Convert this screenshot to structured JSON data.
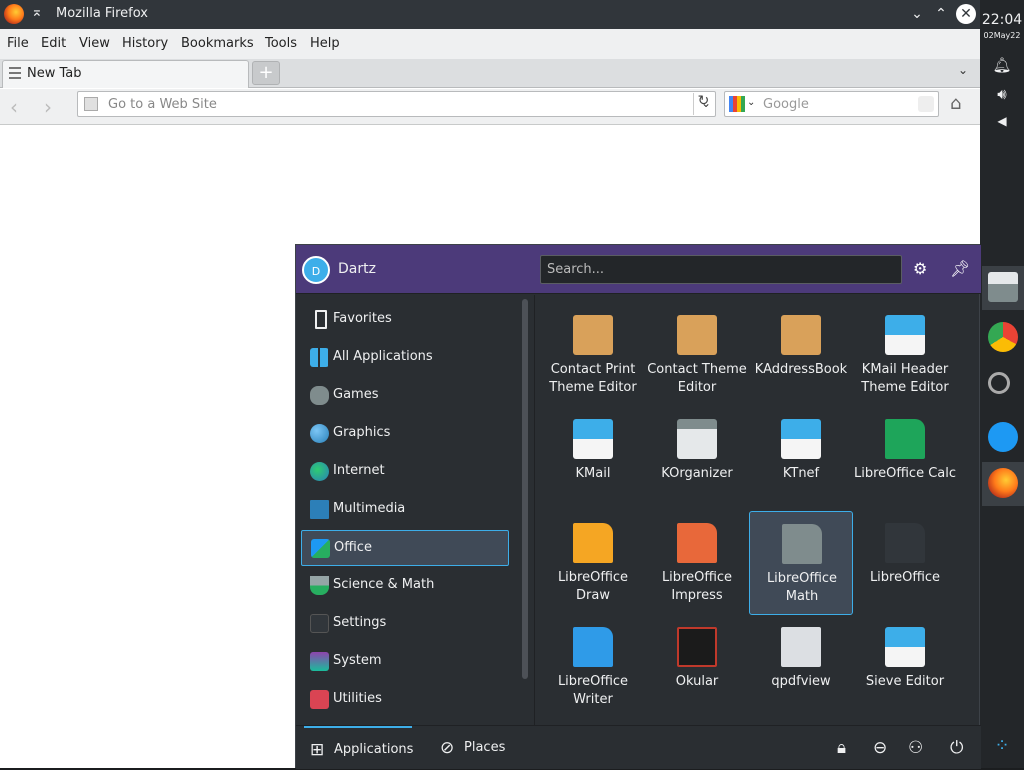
{
  "firefox": {
    "window_title": "Mozilla Firefox",
    "menu": [
      "File",
      "Edit",
      "View",
      "History",
      "Bookmarks",
      "Tools",
      "Help"
    ],
    "tab_label": "New Tab",
    "new_tab_symbol": "+",
    "url_placeholder": "Go to a Web Site",
    "search_placeholder": "Google"
  },
  "panel": {
    "time": "22:04",
    "date": "02May22"
  },
  "launcher": {
    "user": "Dartz",
    "avatar_initial": "D",
    "search_placeholder": "Search...",
    "categories": [
      {
        "label": "Favorites",
        "icon": "bookmark-icon",
        "color": "#2a2e32"
      },
      {
        "label": "All Applications",
        "icon": "grid-icon",
        "color": "#3daee9"
      },
      {
        "label": "Games",
        "icon": "gamepad-icon",
        "color": "#7f8c8d"
      },
      {
        "label": "Graphics",
        "icon": "graphics-icon",
        "color": "#2980b9"
      },
      {
        "label": "Internet",
        "icon": "globe-icon",
        "color": "#27ae60"
      },
      {
        "label": "Multimedia",
        "icon": "multimedia-icon",
        "color": "#2c7fb8"
      },
      {
        "label": "Office",
        "icon": "office-icon",
        "color": "#1d99f3"
      },
      {
        "label": "Science & Math",
        "icon": "flask-icon",
        "color": "#95a5a6"
      },
      {
        "label": "Settings",
        "icon": "settings-icon",
        "color": "#31363b"
      },
      {
        "label": "System",
        "icon": "system-icon",
        "color": "#8e44ad"
      },
      {
        "label": "Utilities",
        "icon": "utilities-icon",
        "color": "#da4453"
      }
    ],
    "selected_category": "Office",
    "apps": [
      {
        "label": "Contact Print Theme Editor",
        "icon": "addressbook-icon",
        "color": "#d9a15a"
      },
      {
        "label": "Contact Theme Editor",
        "icon": "addressbook-icon",
        "color": "#d9a15a"
      },
      {
        "label": "KAddressBook",
        "icon": "addressbook-icon",
        "color": "#d9a15a"
      },
      {
        "label": "KMail Header Theme Editor",
        "icon": "kmail-icon",
        "color": "#3daee9"
      },
      {
        "label": "KMail",
        "icon": "kmail-icon",
        "color": "#3daee9"
      },
      {
        "label": "KOrganizer",
        "icon": "calendar-icon",
        "color": "#e5e8ea"
      },
      {
        "label": "KTnef",
        "icon": "attachment-mail-icon",
        "color": "#3daee9"
      },
      {
        "label": "LibreOffice Calc",
        "icon": "calc-icon",
        "color": "#1ea55a"
      },
      {
        "label": "LibreOffice Draw",
        "icon": "draw-icon",
        "color": "#f5a623"
      },
      {
        "label": "LibreOffice Impress",
        "icon": "impress-icon",
        "color": "#e8683a"
      },
      {
        "label": "LibreOffice Math",
        "icon": "math-icon",
        "color": "#7f8c8d"
      },
      {
        "label": "LibreOffice",
        "icon": "libreoffice-icon",
        "color": "#31363b"
      },
      {
        "label": "LibreOffice Writer",
        "icon": "writer-icon",
        "color": "#2f9be8"
      },
      {
        "label": "Okular",
        "icon": "okular-icon",
        "color": "#1b1b1b"
      },
      {
        "label": "qpdfview",
        "icon": "qpdfview-icon",
        "color": "#dcdfe3"
      },
      {
        "label": "Sieve Editor",
        "icon": "kmail-icon",
        "color": "#3daee9"
      }
    ],
    "selected_app": "LibreOffice Math",
    "footer": {
      "applications": "Applications",
      "places": "Places"
    }
  }
}
